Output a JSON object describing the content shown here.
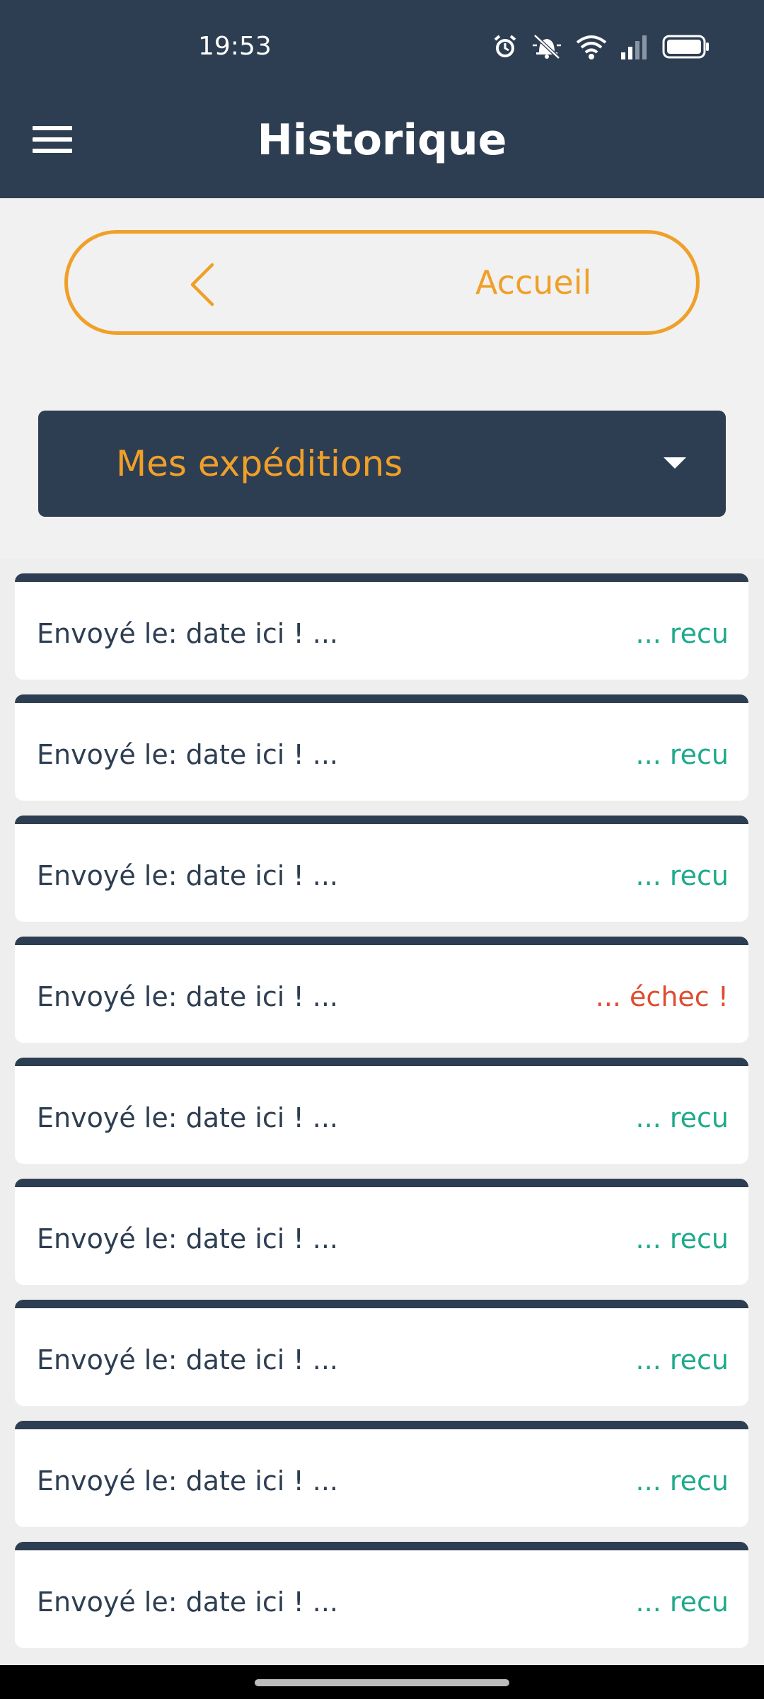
{
  "status_bar": {
    "time": "19:53",
    "icons": [
      "alarm-icon",
      "bell-muted-icon",
      "wifi-icon",
      "signal-icon",
      "battery-icon"
    ]
  },
  "header": {
    "menu_icon": "hamburger-menu-icon",
    "title": "Historique"
  },
  "home_button": {
    "label": "Accueil",
    "icon": "chevron-left-icon"
  },
  "filter_dropdown": {
    "selected": "Mes expéditions",
    "icon": "caret-down-icon"
  },
  "shipments": [
    {
      "sent_text": "Envoyé le: date ici ! ...",
      "status_text": "... recu",
      "status": "received"
    },
    {
      "sent_text": "Envoyé le: date ici ! ...",
      "status_text": "... recu",
      "status": "received"
    },
    {
      "sent_text": "Envoyé le: date ici ! ...",
      "status_text": "... recu",
      "status": "received"
    },
    {
      "sent_text": "Envoyé le: date ici ! ...",
      "status_text": "... échec !",
      "status": "failed"
    },
    {
      "sent_text": "Envoyé le: date ici ! ...",
      "status_text": "... recu",
      "status": "received"
    },
    {
      "sent_text": "Envoyé le: date ici ! ...",
      "status_text": "... recu",
      "status": "received"
    },
    {
      "sent_text": "Envoyé le: date ici ! ...",
      "status_text": "... recu",
      "status": "received"
    },
    {
      "sent_text": "Envoyé le: date ici ! ...",
      "status_text": "... recu",
      "status": "received"
    },
    {
      "sent_text": "Envoyé le: date ici ! ...",
      "status_text": "... recu",
      "status": "received"
    }
  ],
  "colors": {
    "primary_dark": "#2e3e52",
    "accent_orange": "#f0a028",
    "status_received": "#1eaa8c",
    "status_failed": "#e04b2f",
    "background": "#f1f1f1",
    "card": "#ffffff"
  }
}
